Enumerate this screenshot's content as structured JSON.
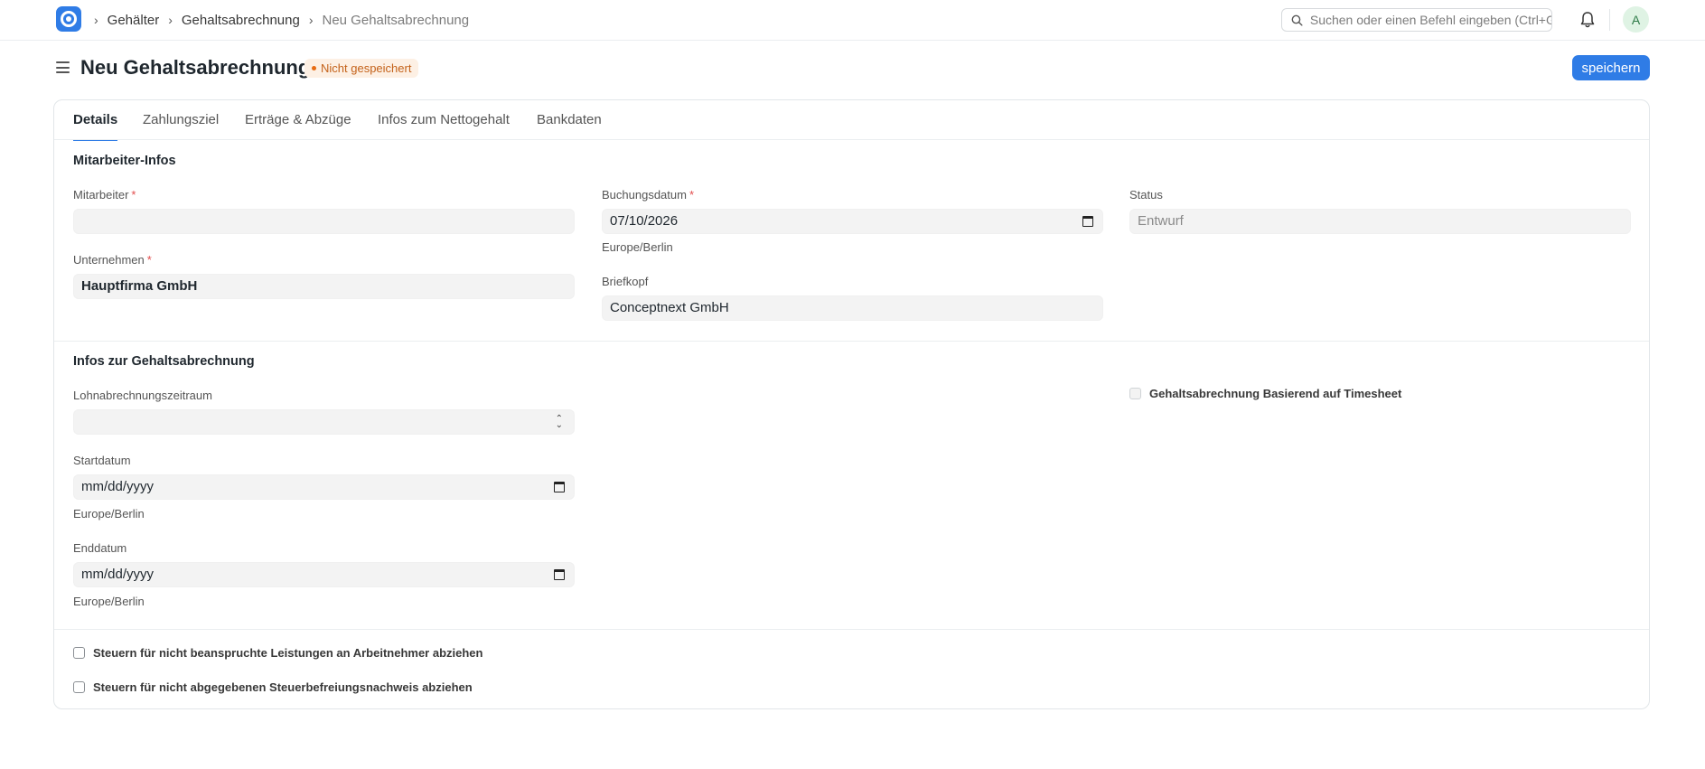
{
  "navbar": {
    "breadcrumbs": [
      "Gehälter",
      "Gehaltsabrechnung",
      "Neu Gehaltsabrechnung"
    ],
    "search_placeholder": "Suchen oder einen Befehl eingeben (Ctrl+G)",
    "avatar_initial": "A"
  },
  "page": {
    "title": "Neu Gehaltsabrechnung",
    "status_badge": "Nicht gespeichert",
    "save_label": "speichern"
  },
  "tabs": [
    "Details",
    "Zahlungsziel",
    "Erträge & Abzüge",
    "Infos zum Nettogehalt",
    "Bankdaten"
  ],
  "sections": {
    "employee": {
      "title": "Mitarbeiter-Infos",
      "employee_label": "Mitarbeiter",
      "employee_value": "",
      "posting_date_label": "Buchungsdatum",
      "posting_date_value": "07/10/2026",
      "posting_date_tz": "Europe/Berlin",
      "status_label": "Status",
      "status_value": "Entwurf",
      "company_label": "Unternehmen",
      "company_value": "Hauptfirma GmbH",
      "letterhead_label": "Briefkopf",
      "letterhead_value": "Conceptnext GmbH"
    },
    "salary": {
      "title": "Infos zur Gehaltsabrechnung",
      "payroll_period_label": "Lohnabrechnungszeitraum",
      "payroll_period_value": "",
      "timesheet_label": "Gehaltsabrechnung Basierend auf Timesheet",
      "start_label": "Startdatum",
      "start_placeholder": "mm/dd/yyyy",
      "start_tz": "Europe/Berlin",
      "end_label": "Enddatum",
      "end_placeholder": "mm/dd/yyyy",
      "end_tz": "Europe/Berlin"
    },
    "options": {
      "deduct_unclaimed_benefits": "Steuern für nicht beanspruchte Leistungen an Arbeitnehmer abziehen",
      "deduct_unsubmitted_proof": "Steuern für nicht abgegebenen Steuerbefreiungsnachweis abziehen"
    }
  },
  "colors": {
    "primary": "#2f7ce6",
    "badge_text": "#c4621a",
    "badge_bg": "#fdf0e4",
    "required": "#e24c4c"
  },
  "icons": [
    "app-logo-icon",
    "chevron-right-icon",
    "search-icon",
    "bell-icon",
    "hamburger-icon",
    "calendar-icon",
    "select-updown-icon"
  ]
}
